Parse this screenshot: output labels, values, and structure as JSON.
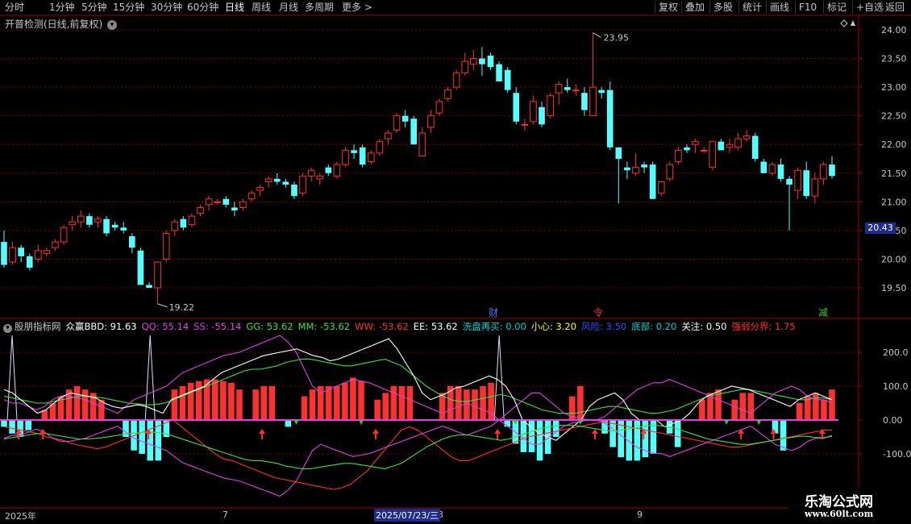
{
  "toolbar": {
    "periods": [
      "分时",
      "1分钟",
      "5分钟",
      "15分钟",
      "30分钟",
      "60分钟",
      "日线",
      "周线",
      "月线",
      "多周期",
      "更多 >"
    ],
    "active_period": "日线",
    "right_buttons": [
      "复权",
      "叠加",
      "多股",
      "统计",
      "画线",
      "F10",
      "标记",
      "+自选",
      "返回"
    ]
  },
  "main": {
    "title": "开普检测(日线,前复权)",
    "high_label": "23.95",
    "low_label": "19.22",
    "current_price_tag": "20.43",
    "event_labels": [
      {
        "text": "财",
        "color": "#4d79ff"
      },
      {
        "text": "令",
        "color": "#ff3030"
      },
      {
        "text": "减",
        "color": "#33cc33"
      }
    ],
    "price_axis": [
      "24.00",
      "23.50",
      "23.00",
      "22.50",
      "22.00",
      "21.50",
      "21.00",
      "20.50",
      "20.00",
      "19.50"
    ]
  },
  "indicator": {
    "name": "股朋指标网",
    "items": [
      {
        "label": "众赢BBD: 91.63",
        "color": "#ffffff"
      },
      {
        "label": "QQ: 55.14",
        "color": "#e040e0"
      },
      {
        "label": "SS: -55.14",
        "color": "#e040e0"
      },
      {
        "label": "GG: 53.62",
        "color": "#40e040"
      },
      {
        "label": "MM: -53.62",
        "color": "#40e040"
      },
      {
        "label": "WW: -53.62",
        "color": "#ff3030"
      },
      {
        "label": "EE: 53.62",
        "color": "#ffffff"
      },
      {
        "label": "洗盘再买: 0.00",
        "color": "#00d0d0"
      },
      {
        "label": "小心: 3.20",
        "color": "#ffff00"
      },
      {
        "label": "风险: 3.50",
        "color": "#3050ff"
      },
      {
        "label": "底部: 0.20",
        "color": "#00d0d0"
      },
      {
        "label": "关注: 0.50",
        "color": "#ffffff"
      },
      {
        "label": "强弱分界: 1.75",
        "color": "#ff3030"
      }
    ],
    "axis": [
      "200.0",
      "100.0",
      "0.00",
      "-100.0"
    ]
  },
  "date_axis": {
    "labels": [
      "2025年",
      "7",
      "8",
      "9"
    ],
    "cursor_date": "2025/07/23/三"
  },
  "watermark": {
    "title": "乐淘公式网",
    "url": "www.60lt.com"
  },
  "colors": {
    "up": "#ff3030",
    "down": "#54ffff",
    "grid": "#7a0000",
    "border": "#a00000"
  },
  "chart_data": [
    {
      "type": "candlestick",
      "title": "开普检测(日线,前复权)",
      "ylim": [
        19.2,
        24.15
      ],
      "ohlc": [
        [
          20.3,
          20.5,
          19.85,
          19.9
        ],
        [
          19.95,
          20.3,
          19.9,
          20.2
        ],
        [
          20.2,
          20.25,
          19.95,
          20.05
        ],
        [
          20.05,
          20.1,
          19.8,
          19.85
        ],
        [
          20.0,
          20.25,
          19.95,
          20.15
        ],
        [
          20.1,
          20.2,
          20.05,
          20.15
        ],
        [
          20.2,
          20.35,
          20.15,
          20.3
        ],
        [
          20.3,
          20.6,
          20.25,
          20.55
        ],
        [
          20.6,
          20.75,
          20.5,
          20.65
        ],
        [
          20.65,
          20.85,
          20.55,
          20.75
        ],
        [
          20.75,
          20.8,
          20.55,
          20.6
        ],
        [
          20.65,
          20.75,
          20.55,
          20.7
        ],
        [
          20.7,
          20.75,
          20.4,
          20.45
        ],
        [
          20.6,
          20.65,
          20.5,
          20.55
        ],
        [
          20.55,
          20.65,
          20.45,
          20.5
        ],
        [
          20.4,
          20.45,
          20.1,
          20.2
        ],
        [
          20.15,
          20.2,
          19.55,
          19.55
        ],
        [
          19.55,
          19.6,
          19.5,
          19.5
        ],
        [
          19.5,
          19.95,
          19.22,
          19.95
        ],
        [
          20.0,
          20.5,
          19.95,
          20.45
        ],
        [
          20.5,
          20.7,
          20.4,
          20.65
        ],
        [
          20.7,
          20.75,
          20.5,
          20.55
        ],
        [
          20.6,
          20.8,
          20.55,
          20.75
        ],
        [
          20.8,
          20.95,
          20.75,
          20.9
        ],
        [
          20.95,
          21.1,
          20.85,
          21.05
        ],
        [
          21.0,
          21.05,
          20.95,
          21.0
        ],
        [
          21.05,
          21.1,
          20.9,
          20.95
        ],
        [
          20.9,
          21.0,
          20.75,
          20.85
        ],
        [
          20.9,
          21.05,
          20.85,
          21.0
        ],
        [
          21.05,
          21.2,
          21.0,
          21.15
        ],
        [
          21.2,
          21.3,
          21.1,
          21.25
        ],
        [
          21.35,
          21.45,
          21.25,
          21.4
        ],
        [
          21.4,
          21.5,
          21.3,
          21.35
        ],
        [
          21.35,
          21.4,
          21.25,
          21.3
        ],
        [
          21.3,
          21.35,
          21.05,
          21.1
        ],
        [
          21.15,
          21.5,
          21.1,
          21.45
        ],
        [
          21.45,
          21.6,
          21.35,
          21.55
        ],
        [
          21.4,
          21.5,
          21.3,
          21.45
        ],
        [
          21.6,
          21.65,
          21.45,
          21.5
        ],
        [
          21.45,
          21.7,
          21.4,
          21.65
        ],
        [
          21.65,
          21.95,
          21.6,
          21.9
        ],
        [
          21.9,
          22.0,
          21.75,
          21.85
        ],
        [
          21.95,
          22.0,
          21.6,
          21.65
        ],
        [
          21.7,
          21.9,
          21.65,
          21.85
        ],
        [
          21.85,
          22.1,
          21.8,
          22.05
        ],
        [
          22.1,
          22.25,
          22.0,
          22.2
        ],
        [
          22.25,
          22.55,
          22.2,
          22.5
        ],
        [
          22.5,
          22.6,
          22.3,
          22.4
        ],
        [
          22.45,
          22.5,
          22.0,
          22.0
        ],
        [
          21.8,
          22.3,
          21.8,
          22.2
        ],
        [
          22.3,
          22.6,
          22.2,
          22.5
        ],
        [
          22.55,
          22.8,
          22.5,
          22.75
        ],
        [
          22.8,
          23.0,
          22.75,
          22.95
        ],
        [
          23.0,
          23.3,
          22.95,
          23.25
        ],
        [
          23.25,
          23.6,
          23.2,
          23.45
        ],
        [
          23.4,
          23.65,
          23.3,
          23.5
        ],
        [
          23.5,
          23.7,
          23.2,
          23.4
        ],
        [
          23.55,
          23.6,
          23.3,
          23.35
        ],
        [
          23.4,
          23.45,
          23.1,
          23.1
        ],
        [
          23.3,
          23.35,
          22.9,
          22.95
        ],
        [
          22.9,
          23.0,
          22.35,
          22.4
        ],
        [
          22.35,
          22.45,
          22.25,
          22.35
        ],
        [
          22.4,
          22.85,
          22.35,
          22.75
        ],
        [
          22.65,
          22.75,
          22.3,
          22.35
        ],
        [
          22.5,
          22.9,
          22.45,
          22.85
        ],
        [
          22.9,
          23.1,
          22.7,
          23.05
        ],
        [
          23.0,
          23.15,
          22.9,
          22.95
        ],
        [
          22.95,
          23.05,
          22.85,
          22.95
        ],
        [
          22.9,
          23.0,
          22.5,
          22.6
        ],
        [
          22.5,
          23.95,
          22.5,
          23.0
        ],
        [
          22.95,
          23.0,
          22.8,
          22.9
        ],
        [
          22.95,
          23.1,
          21.9,
          21.95
        ],
        [
          21.95,
          21.95,
          20.97,
          21.75
        ],
        [
          21.6,
          21.7,
          21.4,
          21.55
        ],
        [
          21.5,
          21.85,
          21.45,
          21.6
        ],
        [
          21.65,
          21.7,
          21.5,
          21.6
        ],
        [
          21.65,
          21.7,
          21.05,
          21.05
        ],
        [
          21.15,
          21.35,
          21.1,
          21.35
        ],
        [
          21.4,
          21.7,
          21.35,
          21.65
        ],
        [
          21.7,
          21.95,
          21.65,
          21.9
        ],
        [
          21.95,
          22.0,
          21.85,
          21.9
        ],
        [
          22.0,
          22.1,
          21.85,
          22.05
        ],
        [
          21.9,
          21.95,
          21.85,
          21.9
        ],
        [
          21.6,
          22.05,
          21.55,
          22.05
        ],
        [
          22.05,
          22.1,
          21.9,
          21.9
        ],
        [
          21.95,
          22.1,
          21.85,
          22.0
        ],
        [
          21.95,
          22.2,
          21.9,
          22.1
        ],
        [
          22.1,
          22.25,
          22.05,
          22.15
        ],
        [
          22.15,
          22.2,
          21.7,
          21.75
        ],
        [
          21.7,
          21.75,
          21.5,
          21.5
        ],
        [
          21.5,
          21.7,
          21.45,
          21.65
        ],
        [
          21.65,
          21.75,
          21.35,
          21.4
        ],
        [
          21.4,
          21.45,
          20.5,
          21.3
        ],
        [
          21.2,
          21.6,
          21.05,
          21.55
        ],
        [
          21.55,
          21.7,
          21.05,
          21.1
        ],
        [
          21.1,
          21.5,
          20.97,
          21.4
        ],
        [
          21.4,
          21.7,
          21.3,
          21.65
        ],
        [
          21.65,
          21.8,
          21.4,
          21.45
        ]
      ]
    },
    {
      "type": "bar+line",
      "title": "股朋指标网",
      "ylim": [
        -150,
        280
      ],
      "bars": [
        -20,
        -40,
        -50,
        -30,
        0,
        30,
        50,
        70,
        90,
        100,
        90,
        80,
        60,
        0,
        0,
        -50,
        -90,
        -100,
        -120,
        -120,
        -50,
        90,
        100,
        110,
        115,
        120,
        120,
        115,
        110,
        90,
        0,
        90,
        100,
        100,
        0,
        -20,
        0,
        70,
        90,
        100,
        100,
        100,
        110,
        125,
        115,
        0,
        60,
        80,
        100,
        100,
        100,
        0,
        0,
        0,
        80,
        100,
        100,
        90,
        90,
        100,
        110,
        0,
        -20,
        -70,
        -95,
        -95,
        -120,
        -100,
        -50,
        0,
        70,
        100,
        0,
        0,
        -40,
        -80,
        -110,
        -120,
        -120,
        -110,
        -100,
        0,
        -40,
        -80,
        0,
        0,
        60,
        80,
        90,
        0,
        60,
        80,
        80,
        0,
        0,
        -40,
        -90,
        0,
        50,
        70,
        80,
        60,
        90
      ],
      "white": [
        90,
        80,
        60,
        40,
        20,
        30,
        50,
        70,
        80,
        75,
        70,
        65,
        50,
        40,
        35,
        40,
        45,
        40,
        30,
        20,
        60,
        70,
        80,
        90,
        100,
        120,
        140,
        150,
        160,
        170,
        180,
        190,
        195,
        200,
        205,
        210,
        200,
        190,
        185,
        175,
        180,
        190,
        200,
        210,
        220,
        230,
        240,
        210,
        170,
        130,
        80,
        60,
        70,
        80,
        95,
        100,
        110,
        120,
        130,
        120,
        100,
        60,
        0,
        -20,
        -40,
        -50,
        -60,
        -40,
        -20,
        0,
        40,
        60,
        70,
        80,
        60,
        20,
        0,
        0,
        0,
        -20,
        -10,
        0,
        20,
        50,
        70,
        80,
        90,
        100,
        95,
        90,
        80,
        70,
        60,
        50,
        40,
        60,
        70,
        80,
        70,
        60
      ],
      "magenta": [
        60,
        50,
        50,
        40,
        30,
        40,
        60,
        70,
        70,
        65,
        60,
        50,
        40,
        30,
        20,
        40,
        60,
        70,
        80,
        90,
        100,
        120,
        140,
        150,
        160,
        170,
        180,
        190,
        195,
        200,
        210,
        220,
        230,
        240,
        250,
        230,
        200,
        150,
        100,
        80,
        90,
        100,
        110,
        120,
        115,
        110,
        100,
        90,
        80,
        70,
        60,
        50,
        40,
        30,
        20,
        30,
        40,
        50,
        40,
        30,
        20,
        0,
        20,
        40,
        60,
        80,
        80,
        60,
        40,
        20,
        10,
        5,
        0,
        0,
        10,
        30,
        50,
        70,
        90,
        100,
        110,
        110,
        120,
        110,
        100,
        90,
        80,
        70,
        60,
        50,
        40,
        30,
        20,
        40,
        60,
        80,
        90,
        100,
        90,
        70,
        60,
        60,
        50
      ],
      "green": [
        70,
        65,
        60,
        55,
        50,
        50,
        55,
        60,
        65,
        70,
        70,
        68,
        65,
        60,
        55,
        50,
        48,
        45,
        45,
        48,
        55,
        65,
        75,
        85,
        95,
        105,
        115,
        125,
        135,
        145,
        150,
        150,
        155,
        160,
        170,
        175,
        180,
        180,
        175,
        170,
        165,
        160,
        160,
        165,
        170,
        175,
        180,
        170,
        160,
        140,
        120,
        100,
        85,
        70,
        60,
        55,
        55,
        60,
        65,
        70,
        75,
        70,
        60,
        50,
        40,
        30,
        25,
        20,
        20,
        20,
        25,
        30,
        35,
        40,
        40,
        35,
        30,
        25,
        20,
        20,
        25,
        30,
        40,
        50,
        60,
        70,
        75,
        80,
        85,
        90,
        90,
        85,
        80,
        75,
        70,
        65,
        60,
        60,
        65,
        65,
        60
      ],
      "red_line": [
        -20,
        -25,
        -30,
        -35,
        -40,
        -50,
        -55,
        -60,
        -70,
        -75,
        -80,
        -85,
        -80,
        -70,
        -60,
        -50,
        -40,
        -30,
        -20,
        -10,
        0,
        -20,
        -40,
        -60,
        -80,
        -100,
        -115,
        -120,
        -130,
        -140,
        -150,
        -160,
        -170,
        -175,
        -180,
        -185,
        -190,
        -195,
        -200,
        -205,
        -200,
        -190,
        -170,
        -150,
        -120,
        -90,
        -60,
        -30,
        -20,
        -30,
        -50,
        -70,
        -90,
        -110,
        -120,
        -120,
        -110,
        -100,
        -90,
        -80,
        -70,
        -60,
        -50,
        -45,
        -40,
        -35,
        -30,
        -25,
        -20,
        -15,
        -10,
        -5,
        -10,
        -15,
        -20,
        -25,
        -30,
        -35,
        -40,
        -45,
        -50,
        -55,
        -60,
        -65,
        -70,
        -75,
        -80,
        -80,
        -75,
        -70,
        -65,
        -60,
        -55,
        -50,
        -45,
        -40,
        -35,
        -30,
        -30
      ],
      "arrow_indices": [
        1,
        4,
        17,
        31,
        45,
        60,
        72,
        78,
        90,
        94,
        100
      ]
    }
  ]
}
